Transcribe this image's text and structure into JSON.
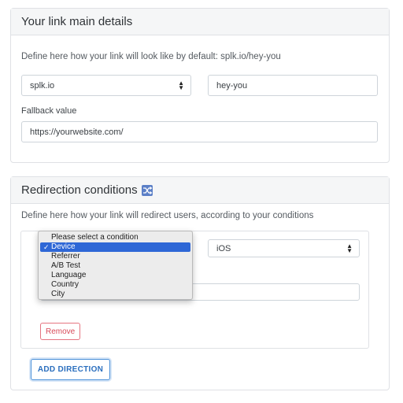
{
  "main_details": {
    "title": "Your link main details",
    "description": "Define here how your link will look like by default: splk.io/hey-you",
    "domain_select": {
      "value": "splk.io"
    },
    "slug_input": {
      "value": "hey-you"
    },
    "fallback_label": "Fallback value",
    "fallback_input": {
      "value": "https://yourwebsite.com/"
    }
  },
  "redirection": {
    "title": "Redirection conditions",
    "title_icon": "shuffle-icon",
    "description": "Define here how your link will redirect users, according to your conditions",
    "condition_dropdown": {
      "options": [
        "Please select a condition",
        "Device",
        "Referrer",
        "A/B Test",
        "Language",
        "Country",
        "City"
      ],
      "selected": "Device",
      "check_mark": "✓"
    },
    "value_select": {
      "value": "iOS"
    },
    "remove_label": "Remove",
    "add_label": "ADD DIRECTION"
  }
}
